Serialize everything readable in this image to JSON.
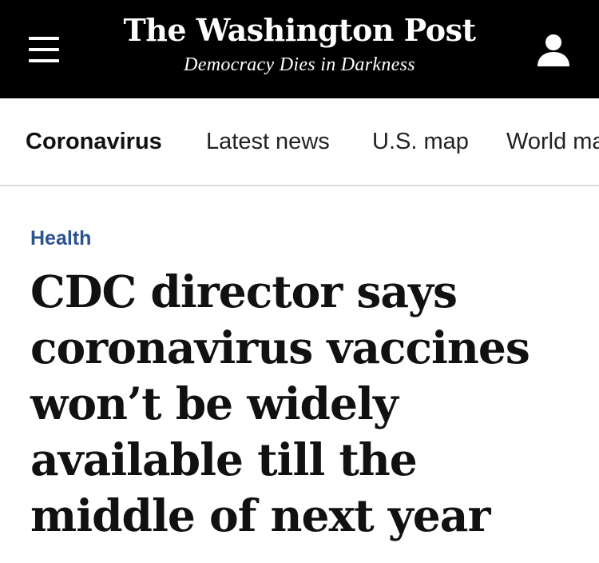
{
  "header": {
    "logo_text": "The Washington Post",
    "tagline": "Democracy Dies in Darkness",
    "menu_icon": "hamburger-menu-icon",
    "account_icon": "user-account-icon",
    "background_color": "#000000"
  },
  "subnav": {
    "items": [
      {
        "label": "Coronavirus",
        "active": true
      },
      {
        "label": "Latest news",
        "active": false
      },
      {
        "label": "U.S. map",
        "active": false
      },
      {
        "label": "World ma",
        "active": false
      }
    ]
  },
  "article": {
    "section": "Health",
    "section_color": "#2a5390",
    "headline": "CDC director says coronavirus vaccines won’t be widely available till the middle of next year"
  }
}
